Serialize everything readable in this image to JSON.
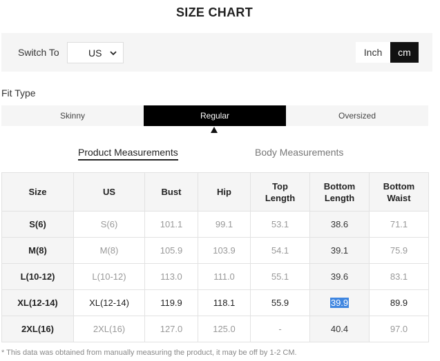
{
  "title": "SIZE CHART",
  "switch": {
    "label": "Switch To",
    "region_value": "US",
    "units": [
      "Inch",
      "cm"
    ],
    "active_unit": "cm"
  },
  "fit": {
    "label": "Fit Type",
    "tabs": [
      "Skinny",
      "Regular",
      "Oversized"
    ],
    "active": "Regular"
  },
  "measure_tabs": {
    "product": "Product Measurements",
    "body": "Body Measurements",
    "active": "product"
  },
  "table": {
    "headers": [
      [
        "Size"
      ],
      [
        "US"
      ],
      [
        "Bust"
      ],
      [
        "Hip"
      ],
      [
        "Top",
        "Length"
      ],
      [
        "Bottom",
        "Length"
      ],
      [
        "Bottom",
        "Waist"
      ]
    ],
    "rows": [
      [
        "S(6)",
        "S(6)",
        "101.1",
        "99.1",
        "53.1",
        "38.6",
        "71.1"
      ],
      [
        "M(8)",
        "M(8)",
        "105.9",
        "103.9",
        "54.1",
        "39.1",
        "75.9"
      ],
      [
        "L(10-12)",
        "L(10-12)",
        "113.0",
        "111.0",
        "55.1",
        "39.6",
        "83.1"
      ],
      [
        "XL(12-14)",
        "XL(12-14)",
        "119.9",
        "118.1",
        "55.9",
        "39.9",
        "89.9"
      ],
      [
        "2XL(16)",
        "2XL(16)",
        "127.0",
        "125.0",
        "-",
        "40.4",
        "97.0"
      ]
    ],
    "highlight_row": 3,
    "highlight_column": 5,
    "selected_cell": {
      "row": 3,
      "col": 5
    }
  },
  "note": "* This data was obtained from manually measuring the product, it may be off by 1-2 CM.",
  "colors": {
    "accent": "#000000",
    "panel_bg": "#f5f5f5",
    "selection": "#3f86e0"
  },
  "icons": {
    "select": "chevron-down-icon",
    "fit": "caret-up-icon"
  }
}
